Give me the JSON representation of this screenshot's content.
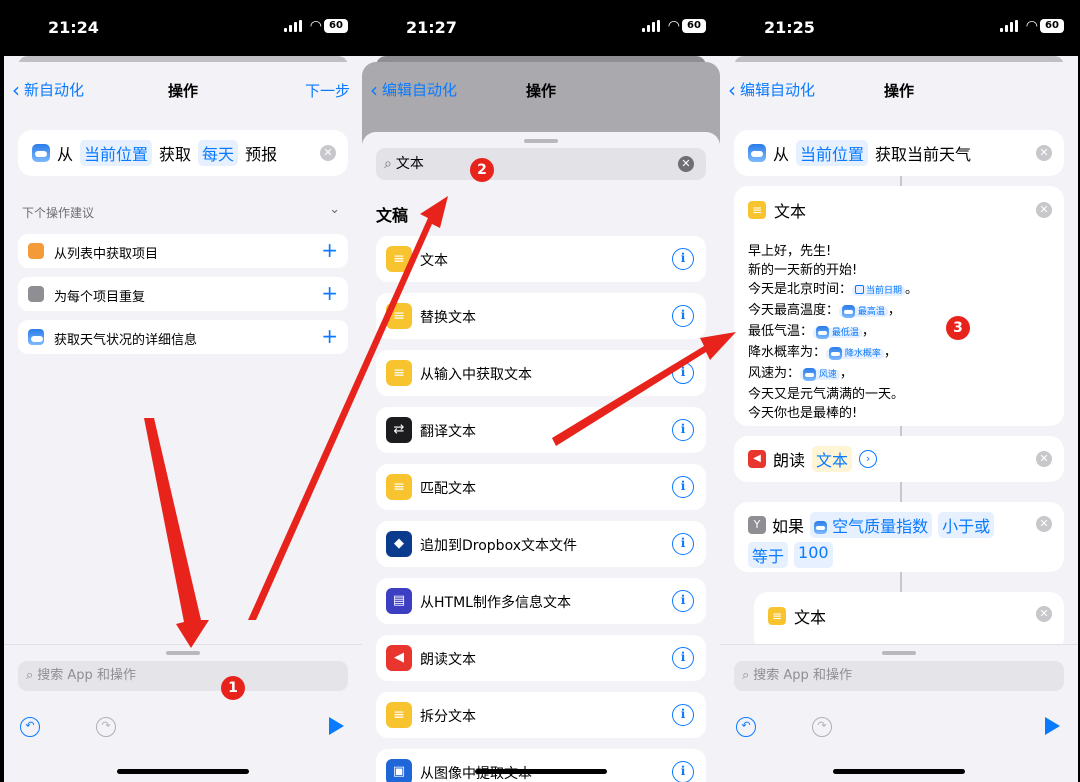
{
  "phone1": {
    "status": {
      "time": "21:24",
      "battery": "60"
    },
    "nav": {
      "back": "新自动化",
      "title": "操作",
      "next": "下一步"
    },
    "action": {
      "from": "从",
      "location": "当前位置",
      "get": "获取",
      "daily": "每天",
      "forecast": "预报"
    },
    "suggestions_title": "下个操作建议",
    "suggestions": [
      {
        "label": "从列表中获取项目",
        "icon": "list-icon",
        "color": "#f29b38"
      },
      {
        "label": "为每个项目重复",
        "icon": "repeat-icon",
        "color": "#8e8e93"
      },
      {
        "label": "获取天气状况的详细信息",
        "icon": "weather-icon",
        "color": "#2b7de9"
      }
    ],
    "search_placeholder": "搜索 App 和操作",
    "badge": "1"
  },
  "phone2": {
    "status": {
      "time": "21:27",
      "battery": "60"
    },
    "nav": {
      "back": "编辑自动化",
      "title": "操作"
    },
    "search_value": "文本",
    "section": "文稿",
    "results": [
      {
        "label": "文本",
        "icon": "note-icon"
      },
      {
        "label": "替换文本",
        "icon": "note-icon"
      },
      {
        "label": "从输入中获取文本",
        "icon": "note-icon"
      },
      {
        "label": "翻译文本",
        "icon": "translate-icon"
      },
      {
        "label": "匹配文本",
        "icon": "note-icon"
      },
      {
        "label": "追加到Dropbox文本文件",
        "icon": "dropbox-icon"
      },
      {
        "label": "从HTML制作多信息文本",
        "icon": "html-icon"
      },
      {
        "label": "朗读文本",
        "icon": "speak-icon"
      },
      {
        "label": "拆分文本",
        "icon": "note-icon"
      },
      {
        "label": "从图像中提取文本",
        "icon": "image-text-icon"
      }
    ],
    "badge": "2"
  },
  "phone3": {
    "status": {
      "time": "21:25",
      "battery": "60"
    },
    "nav": {
      "back": "编辑自动化",
      "title": "操作"
    },
    "action1": {
      "from": "从",
      "location": "当前位置",
      "rest": "获取当前天气"
    },
    "text_card": {
      "title": "文本",
      "l1": "早上好，先生!",
      "l2": "新的一天新的开始!",
      "l3_pre": "今天是北京时间：",
      "l3_var": "当前日期",
      "l3_post": "。",
      "l4_pre": "今天最高温度：",
      "l4_var": "最高温",
      "l4_post": "，",
      "l5_pre": "最低气温：",
      "l5_var": "最低温",
      "l5_post": "，",
      "l6_pre": "降水概率为：",
      "l6_var": "降水概率",
      "l6_post": "，",
      "l7_pre": "风速为：",
      "l7_var": "风速",
      "l7_post": "，",
      "l8": "今天又是元气满满的一天。",
      "l9": "今天你也是最棒的!"
    },
    "speak": {
      "label": "朗读",
      "var": "文本"
    },
    "if": {
      "label": "如果",
      "var": "空气质量指数",
      "cond1": "小于或",
      "cond2": "等于",
      "value": "100"
    },
    "text_card2_title": "文本",
    "search_placeholder": "搜索 App 和操作",
    "badge": "3"
  },
  "accent": "#0a7aff",
  "arrow_color": "#e8231c"
}
